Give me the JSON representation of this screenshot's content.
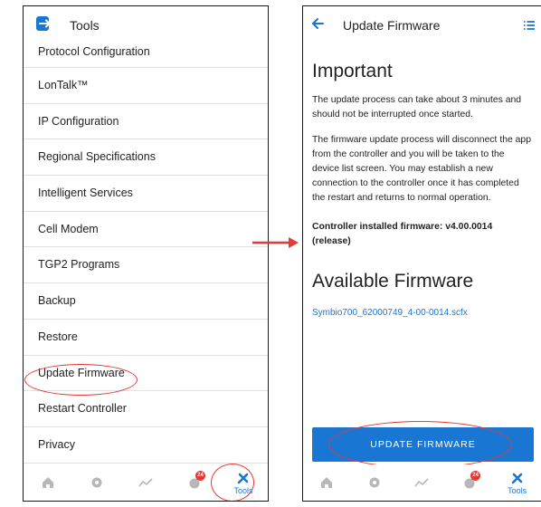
{
  "left": {
    "header_title": "Tools",
    "menu_items": [
      "Protocol Configuration",
      "LonTalk™",
      "IP Configuration",
      "Regional Specifications",
      "Intelligent Services",
      "Cell Modem",
      "TGP2 Programs",
      "Backup",
      "Restore",
      "Update Firmware",
      "Restart Controller",
      "Privacy"
    ],
    "nav": {
      "alarm_badge": "24",
      "tools_label": "Tools"
    }
  },
  "right": {
    "header_title": "Update Firmware",
    "important_heading": "Important",
    "para1": "The update process can take about 3 minutes and should not be interrupted once started.",
    "para2": "The firmware update process will disconnect the app from the controller and you will be taken to the device list screen. You may establish a new connection to the controller once it has completed the restart and returns to normal operation.",
    "installed_firmware": "Controller installed firmware: v4.00.0014 (release)",
    "available_heading": "Available Firmware",
    "firmware_file": "Symbio700_62000749_4-00-0014.scfx",
    "update_button": "UPDATE FIRMWARE",
    "nav": {
      "alarm_badge": "24",
      "tools_label": "Tools"
    }
  },
  "colors": {
    "accent": "#1976d2",
    "highlight": "#e53935",
    "badge": "#e53935"
  }
}
